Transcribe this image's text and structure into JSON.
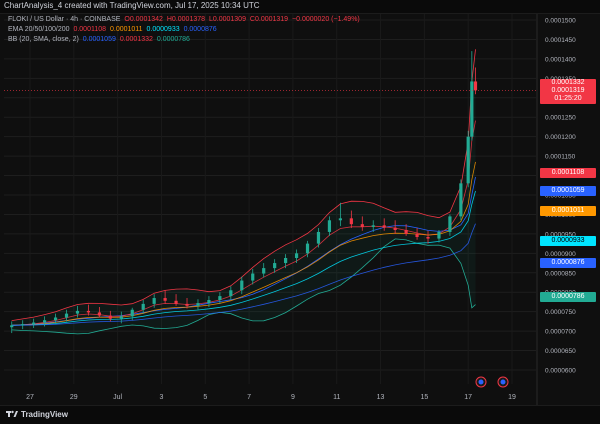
{
  "header": {
    "published": "ChartAnalysis_4 created with TradingView.com, Jul 17, 2025 10:34 UTC"
  },
  "legend": {
    "symbol": "FLOKI / US Dollar · 4h · COINBASE",
    "ohlc": {
      "o": "O0.0001342",
      "h": "H0.0001378",
      "l": "L0.0001309",
      "c": "C0.0001319",
      "chg": "−0.0000020 (−1.49%)"
    },
    "ema_label": "EMA 20/50/100/200",
    "ema_values": [
      "0.0001108",
      "0.0001011",
      "0.0000933",
      "0.0000876"
    ],
    "bb_label": "BB (20, SMA, close, 2)",
    "bb_values": [
      "0.0001059",
      "0.0001332",
      "0.0000786"
    ]
  },
  "price_tags": {
    "current_price": "0.0001332",
    "last_price": "0.0001319",
    "countdown": "01:25:20",
    "ema20": "0.0001108",
    "bb_basis": "0.0001059",
    "ema50": "0.0001011",
    "ema100": "0.0000933",
    "ema200": "0.0000876",
    "bb_lower": "0.0000786"
  },
  "colors": {
    "up": "#22ab94",
    "down": "#f23645",
    "ema20": "#f23645",
    "ema50": "#ff9800",
    "ema100": "#00e5ff",
    "ema200": "#2962ff",
    "bb_basis": "#2962ff",
    "bb_band": "#22ab94",
    "bb_upper": "#f23645"
  },
  "footer": {
    "brand": "TradingView"
  },
  "chart_data": {
    "type": "candlestick",
    "y_ticks": [
      "0.0001500",
      "0.0001450",
      "0.0001400",
      "0.0001350",
      "0.0001300",
      "0.0001250",
      "0.0001200",
      "0.0001150",
      "0.0001100",
      "0.0001050",
      "0.0001000",
      "0.0000950",
      "0.0000900",
      "0.0000850",
      "0.0000800",
      "0.0000750",
      "0.0000700",
      "0.0000650",
      "0.0000600"
    ],
    "x_ticks": [
      "27",
      "29",
      "Jul",
      "3",
      "5",
      "7",
      "9",
      "11",
      "13",
      "15",
      "17",
      "19"
    ],
    "ylim": [
      5.8e-05,
      0.000155
    ],
    "x_start": "2025-06-26",
    "x_end": "2025-07-19",
    "candles_x": [
      "2025-06-26 04:00",
      "2025-06-26 16:00",
      "2025-06-27 04:00",
      "2025-06-27 16:00",
      "2025-06-28 04:00",
      "2025-06-28 16:00",
      "2025-06-29 04:00",
      "2025-06-29 16:00",
      "2025-06-30 04:00",
      "2025-06-30 16:00",
      "2025-07-01 04:00",
      "2025-07-01 16:00",
      "2025-07-02 04:00",
      "2025-07-02 16:00",
      "2025-07-03 04:00",
      "2025-07-03 16:00",
      "2025-07-04 04:00",
      "2025-07-04 16:00",
      "2025-07-05 04:00",
      "2025-07-05 16:00",
      "2025-07-06 04:00",
      "2025-07-06 16:00",
      "2025-07-07 04:00",
      "2025-07-07 16:00",
      "2025-07-08 04:00",
      "2025-07-08 16:00",
      "2025-07-09 04:00",
      "2025-07-09 16:00",
      "2025-07-10 04:00",
      "2025-07-10 16:00",
      "2025-07-11 04:00",
      "2025-07-11 16:00",
      "2025-07-12 04:00",
      "2025-07-12 16:00",
      "2025-07-13 04:00",
      "2025-07-13 16:00",
      "2025-07-14 04:00",
      "2025-07-14 16:00",
      "2025-07-15 04:00",
      "2025-07-15 16:00",
      "2025-07-16 04:00",
      "2025-07-16 16:00",
      "2025-07-17 00:00",
      "2025-07-17 04:00",
      "2025-07-17 08:00"
    ],
    "open": [
      7.1e-05,
      7.15e-05,
      7.18e-05,
      7.22e-05,
      7.28e-05,
      7.35e-05,
      7.45e-05,
      7.52e-05,
      7.48e-05,
      7.4e-05,
      7.32e-05,
      7.38e-05,
      7.55e-05,
      7.7e-05,
      7.85e-05,
      7.78e-05,
      7.7e-05,
      7.65e-05,
      7.72e-05,
      7.8e-05,
      7.9e-05,
      8.05e-05,
      8.3e-05,
      8.48e-05,
      8.62e-05,
      8.75e-05,
      8.88e-05,
      9e-05,
      9.25e-05,
      9.55e-05,
      9.85e-05,
      9.9e-05,
      9.75e-05,
      9.68e-05,
      9.72e-05,
      9.66e-05,
      9.6e-05,
      9.5e-05,
      9.42e-05,
      9.38e-05,
      9.55e-05,
      9.95e-05,
      0.000108,
      0.00012,
      0.0001342
    ],
    "high": [
      7.25e-05,
      7.28e-05,
      7.32e-05,
      7.38e-05,
      7.45e-05,
      7.55e-05,
      7.65e-05,
      7.68e-05,
      7.62e-05,
      7.52e-05,
      7.5e-05,
      7.6e-05,
      7.8e-05,
      7.95e-05,
      8.05e-05,
      7.95e-05,
      7.85e-05,
      7.82e-05,
      7.9e-05,
      8e-05,
      8.15e-05,
      8.4e-05,
      8.6e-05,
      8.75e-05,
      8.85e-05,
      8.98e-05,
      9.1e-05,
      9.32e-05,
      9.65e-05,
      9.95e-05,
      0.000103,
      0.000101,
      9.95e-05,
      9.85e-05,
      9.9e-05,
      9.85e-05,
      9.75e-05,
      9.65e-05,
      9.58e-05,
      9.6e-05,
      0.0001,
      0.000109,
      0.0001215,
      0.000142,
      0.0001378
    ],
    "low": [
      6.95e-05,
      7.05e-05,
      7.08e-05,
      7.12e-05,
      7.18e-05,
      7.25e-05,
      7.35e-05,
      7.4e-05,
      7.35e-05,
      7.25e-05,
      7.2e-05,
      7.28e-05,
      7.45e-05,
      7.6e-05,
      7.7e-05,
      7.65e-05,
      7.58e-05,
      7.55e-05,
      7.62e-05,
      7.7e-05,
      7.8e-05,
      7.95e-05,
      8.2e-05,
      8.38e-05,
      8.5e-05,
      8.62e-05,
      8.75e-05,
      8.9e-05,
      9.15e-05,
      9.45e-05,
      9.7e-05,
      9.65e-05,
      9.58e-05,
      9.55e-05,
      9.58e-05,
      9.5e-05,
      9.45e-05,
      9.35e-05,
      9.25e-05,
      9.28e-05,
      9.45e-05,
      9.85e-05,
      0.000107,
      0.000119,
      0.0001309
    ],
    "close": [
      7.15e-05,
      7.18e-05,
      7.22e-05,
      7.28e-05,
      7.35e-05,
      7.45e-05,
      7.52e-05,
      7.48e-05,
      7.4e-05,
      7.32e-05,
      7.38e-05,
      7.55e-05,
      7.7e-05,
      7.85e-05,
      7.78e-05,
      7.7e-05,
      7.65e-05,
      7.72e-05,
      7.8e-05,
      7.9e-05,
      8.05e-05,
      8.3e-05,
      8.48e-05,
      8.62e-05,
      8.75e-05,
      8.88e-05,
      9e-05,
      9.25e-05,
      9.55e-05,
      9.85e-05,
      9.9e-05,
      9.75e-05,
      9.68e-05,
      9.72e-05,
      9.66e-05,
      9.6e-05,
      9.5e-05,
      9.42e-05,
      9.38e-05,
      9.55e-05,
      9.95e-05,
      0.000108,
      0.00012,
      0.0001342,
      0.0001319
    ]
  }
}
